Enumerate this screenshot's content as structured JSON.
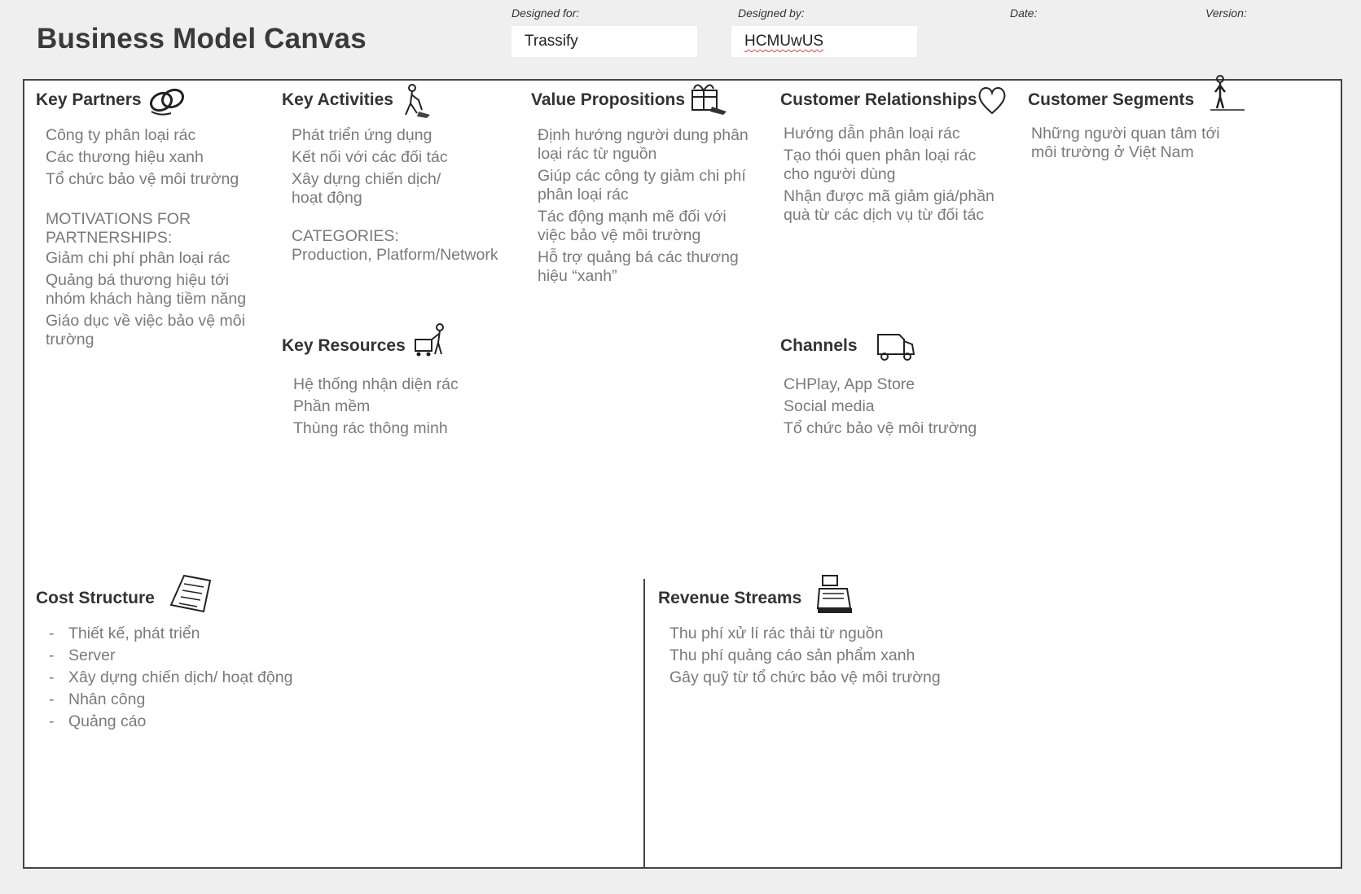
{
  "header": {
    "title": "Business Model Canvas",
    "designed_for_label": "Designed for:",
    "designed_for_value": "Trassify",
    "designed_by_label": "Designed by:",
    "designed_by_value": "HCMUwUS",
    "date_label": "Date:",
    "version_label": "Version:"
  },
  "blocks": {
    "key_partners": {
      "title": "Key Partners",
      "icon": "chain-links-icon",
      "items": [
        "Công ty phân loại rác",
        "Các thương hiệu xanh",
        "Tổ chức bảo vệ môi trường"
      ],
      "motivations_title": "MOTIVATIONS FOR PARTNERSHIPS:",
      "motivations": [
        "Giảm chi phí phân loại rác",
        "Quảng bá thương hiệu tới nhóm khách hàng tiềm năng",
        "Giáo dục về việc bảo vệ môi trường"
      ]
    },
    "key_activities": {
      "title": "Key Activities",
      "icon": "worker-icon",
      "items": [
        "Phát triển ứng dụng",
        "Kết nối với các đối tác",
        "Xây dựng chiến dịch/ hoạt động"
      ],
      "categories_title": "CATEGORIES:",
      "categories": "Production, Platform/Network"
    },
    "key_resources": {
      "title": "Key Resources",
      "icon": "worker-cart-icon",
      "items": [
        "Hệ thống nhận diện rác",
        "Phần mềm",
        "Thùng rác thông minh"
      ]
    },
    "value_propositions": {
      "title": "Value Propositions",
      "icon": "gift-icon",
      "items": [
        "Định hướng người dung phân loại rác từ nguồn",
        "Giúp các công ty giảm chi phí phân loại rác",
        "Tác động mạnh mẽ đối với việc bảo vệ môi trường",
        "Hỗ trợ quảng bá các thương hiệu “xanh”"
      ]
    },
    "customer_relationships": {
      "title": "Customer Relationships",
      "icon": "heart-icon",
      "items": [
        "Hướng dẫn phân loại rác",
        "Tạo thói quen phân loại rác cho người dùng",
        "Nhận được mã giảm giá/phần quà từ các dịch vụ từ đối tác"
      ]
    },
    "channels": {
      "title": "Channels",
      "icon": "truck-icon",
      "items": [
        "CHPlay, App Store",
        "Social media",
        "Tổ chức bảo vệ môi trường"
      ]
    },
    "customer_segments": {
      "title": "Customer Segments",
      "icon": "person-icon",
      "items": [
        "Những người quan tâm tới môi trường ở Việt Nam"
      ]
    },
    "cost_structure": {
      "title": "Cost Structure",
      "icon": "receipt-icon",
      "items": [
        "Thiết kế, phát triển",
        "Server",
        "Xây dựng chiến dịch/ hoạt động",
        "Nhân công",
        "Quảng cáo"
      ]
    },
    "revenue_streams": {
      "title": "Revenue Streams",
      "icon": "cash-register-icon",
      "items": [
        "Thu phí xử lí rác thải từ nguồn",
        "Thu phí quảng cáo sản phẩm xanh",
        "Gây quỹ từ tổ chức bảo vệ môi trường"
      ]
    }
  }
}
